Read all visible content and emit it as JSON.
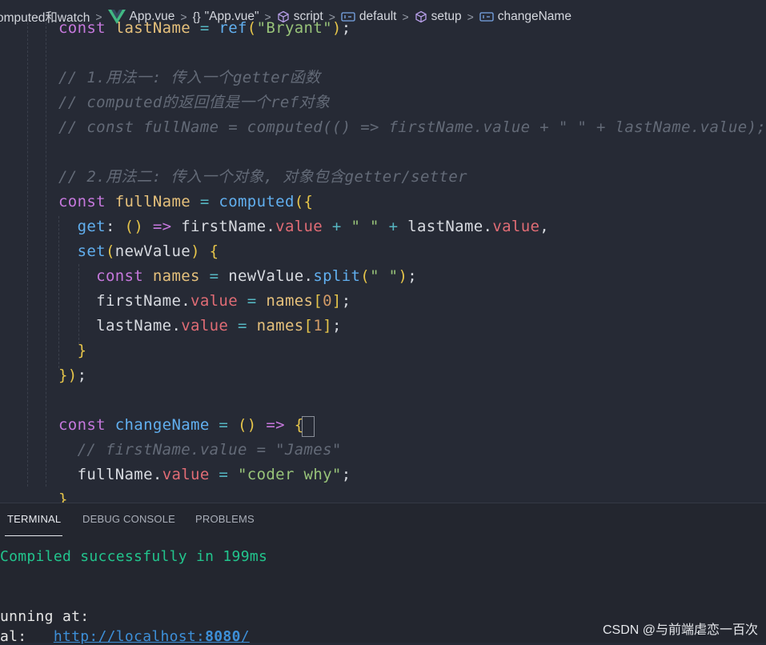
{
  "breadcrumb": [
    {
      "icon": "",
      "label": "omputed和watch"
    },
    {
      "icon": "vue-logo-icon",
      "label": "App.vue"
    },
    {
      "icon": "braces-icon",
      "label": "\"App.vue\""
    },
    {
      "icon": "cube-icon",
      "label": "script"
    },
    {
      "icon": "field-icon",
      "label": "default"
    },
    {
      "icon": "cube-icon",
      "label": "setup"
    },
    {
      "icon": "field-icon",
      "label": "changeName"
    }
  ],
  "code_lines": [
    [
      [
        "kw",
        "const "
      ],
      [
        "vr",
        "lastName"
      ],
      [
        "op",
        " = "
      ],
      [
        "fn",
        "ref"
      ],
      [
        "br",
        "("
      ],
      [
        "st",
        "\"Bryant\""
      ],
      [
        "br",
        ")"
      ],
      [
        "pt",
        ";"
      ]
    ],
    [],
    [
      [
        "cm",
        "// 1.用法一: 传入一个getter函数"
      ]
    ],
    [
      [
        "cm",
        "// computed的返回值是一个ref对象"
      ]
    ],
    [
      [
        "cm",
        "// const fullName = computed(() => firstName.value + \" \" + lastName.value);"
      ]
    ],
    [],
    [
      [
        "cm",
        "// 2.用法二: 传入一个对象, 对象包含getter/setter"
      ]
    ],
    [
      [
        "kw",
        "const "
      ],
      [
        "vr",
        "fullName"
      ],
      [
        "op",
        " = "
      ],
      [
        "fn",
        "computed"
      ],
      [
        "br",
        "({"
      ]
    ],
    [
      [
        "pt",
        "  "
      ],
      [
        "fn",
        "get"
      ],
      [
        "pt",
        ": "
      ],
      [
        "br",
        "()"
      ],
      [
        "kw",
        " => "
      ],
      [
        "pt",
        "firstName."
      ],
      [
        "pr",
        "value"
      ],
      [
        "op",
        " + "
      ],
      [
        "st",
        "\" \""
      ],
      [
        "op",
        " + "
      ],
      [
        "pt",
        "lastName."
      ],
      [
        "pr",
        "value"
      ],
      [
        "pt",
        ","
      ]
    ],
    [
      [
        "pt",
        "  "
      ],
      [
        "fn",
        "set"
      ],
      [
        "br",
        "("
      ],
      [
        "pt",
        "newValue"
      ],
      [
        "br",
        ")"
      ],
      [
        "pt",
        " "
      ],
      [
        "br",
        "{"
      ]
    ],
    [
      [
        "pt",
        "    "
      ],
      [
        "kw",
        "const "
      ],
      [
        "vr",
        "names"
      ],
      [
        "op",
        " = "
      ],
      [
        "pt",
        "newValue."
      ],
      [
        "fn",
        "split"
      ],
      [
        "br",
        "("
      ],
      [
        "st",
        "\" \""
      ],
      [
        "br",
        ")"
      ],
      [
        "pt",
        ";"
      ]
    ],
    [
      [
        "pt",
        "    "
      ],
      [
        "pt",
        "firstName."
      ],
      [
        "pr",
        "value"
      ],
      [
        "op",
        " = "
      ],
      [
        "vr",
        "names"
      ],
      [
        "br",
        "["
      ],
      [
        "nm",
        "0"
      ],
      [
        "br",
        "]"
      ],
      [
        "pt",
        ";"
      ]
    ],
    [
      [
        "pt",
        "    "
      ],
      [
        "pt",
        "lastName."
      ],
      [
        "pr",
        "value"
      ],
      [
        "op",
        " = "
      ],
      [
        "vr",
        "names"
      ],
      [
        "br",
        "["
      ],
      [
        "nm",
        "1"
      ],
      [
        "br",
        "]"
      ],
      [
        "pt",
        ";"
      ]
    ],
    [
      [
        "pt",
        "  "
      ],
      [
        "br",
        "}"
      ]
    ],
    [
      [
        "br",
        "})"
      ],
      [
        "pt",
        ";"
      ]
    ],
    [],
    [
      [
        "kw",
        "const "
      ],
      [
        "fn",
        "changeName"
      ],
      [
        "op",
        " = "
      ],
      [
        "br",
        "()"
      ],
      [
        "kw",
        " => "
      ],
      [
        "br",
        "{"
      ]
    ],
    [
      [
        "pt",
        "  "
      ],
      [
        "cm",
        "// firstName.value = \"James\""
      ]
    ],
    [
      [
        "pt",
        "  "
      ],
      [
        "pt",
        "fullName."
      ],
      [
        "pr",
        "value"
      ],
      [
        "op",
        " = "
      ],
      [
        "st",
        "\"coder why\""
      ],
      [
        "pt",
        ";"
      ]
    ],
    [
      [
        "br",
        "}"
      ]
    ]
  ],
  "panel": {
    "tabs": [
      "TERMINAL",
      "DEBUG CONSOLE",
      "PROBLEMS"
    ],
    "active_tab": "TERMINAL",
    "lines": [
      {
        "text": "Compiled successfully in 199ms",
        "color": "#22c58d"
      },
      {
        "text": "",
        "color": "#e6e6e6"
      },
      {
        "text": "",
        "color": "#e6e6e6"
      },
      {
        "text": "unning at:",
        "color": "#e6e6e6"
      },
      {
        "text": "al:   ",
        "color": "#e6e6e6",
        "link": "http://localhost:",
        "port": "8080",
        "tail": "/"
      }
    ]
  },
  "watermark": "CSDN @与前端虐恋一百次",
  "colors": {
    "background": "#262a35",
    "panel_background": "#23262f",
    "keyword": "#c678dd",
    "function": "#61afef",
    "variable": "#e5c07b",
    "property": "#e06c75",
    "string": "#98c379",
    "comment": "#636a77",
    "success": "#22c58d"
  }
}
